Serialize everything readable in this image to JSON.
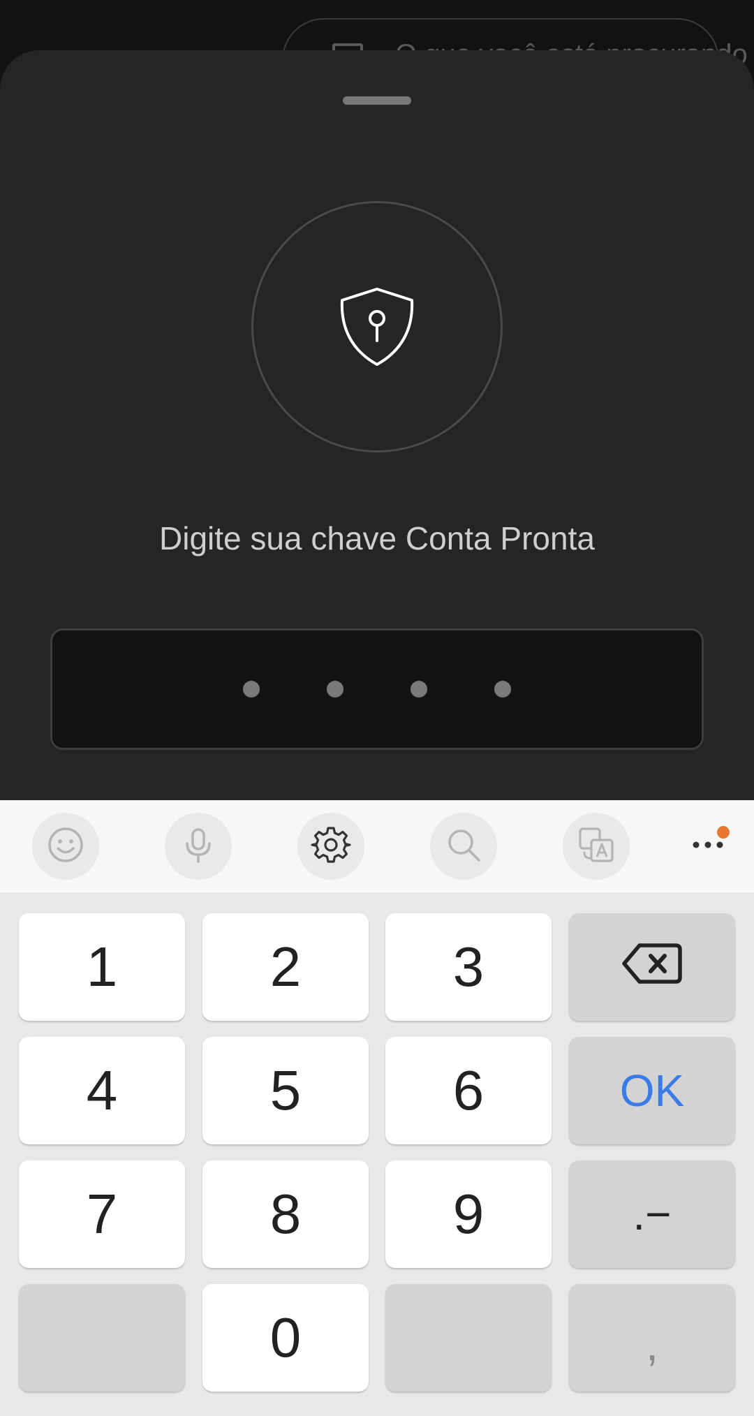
{
  "background_app": {
    "search_hint": "O que você está procurando"
  },
  "sheet": {
    "prompt": "Digite sua chave Conta Pronta",
    "pin": {
      "digits_entered": 4
    }
  },
  "keyboard": {
    "toolbar": {
      "items": [
        "emoji-icon",
        "microphone-icon",
        "settings-icon",
        "search-icon",
        "translate-icon",
        "more-icon"
      ],
      "notification_color": "#e8762e"
    },
    "keys": {
      "k1": "1",
      "k2": "2",
      "k3": "3",
      "k4": "4",
      "k5": "5",
      "k6": "6",
      "k7": "7",
      "k8": "8",
      "k9": "9",
      "k0": "0",
      "ok": "OK",
      "dot_dash": ".−",
      "comma": ","
    },
    "accent_color": "#3b7be6"
  }
}
